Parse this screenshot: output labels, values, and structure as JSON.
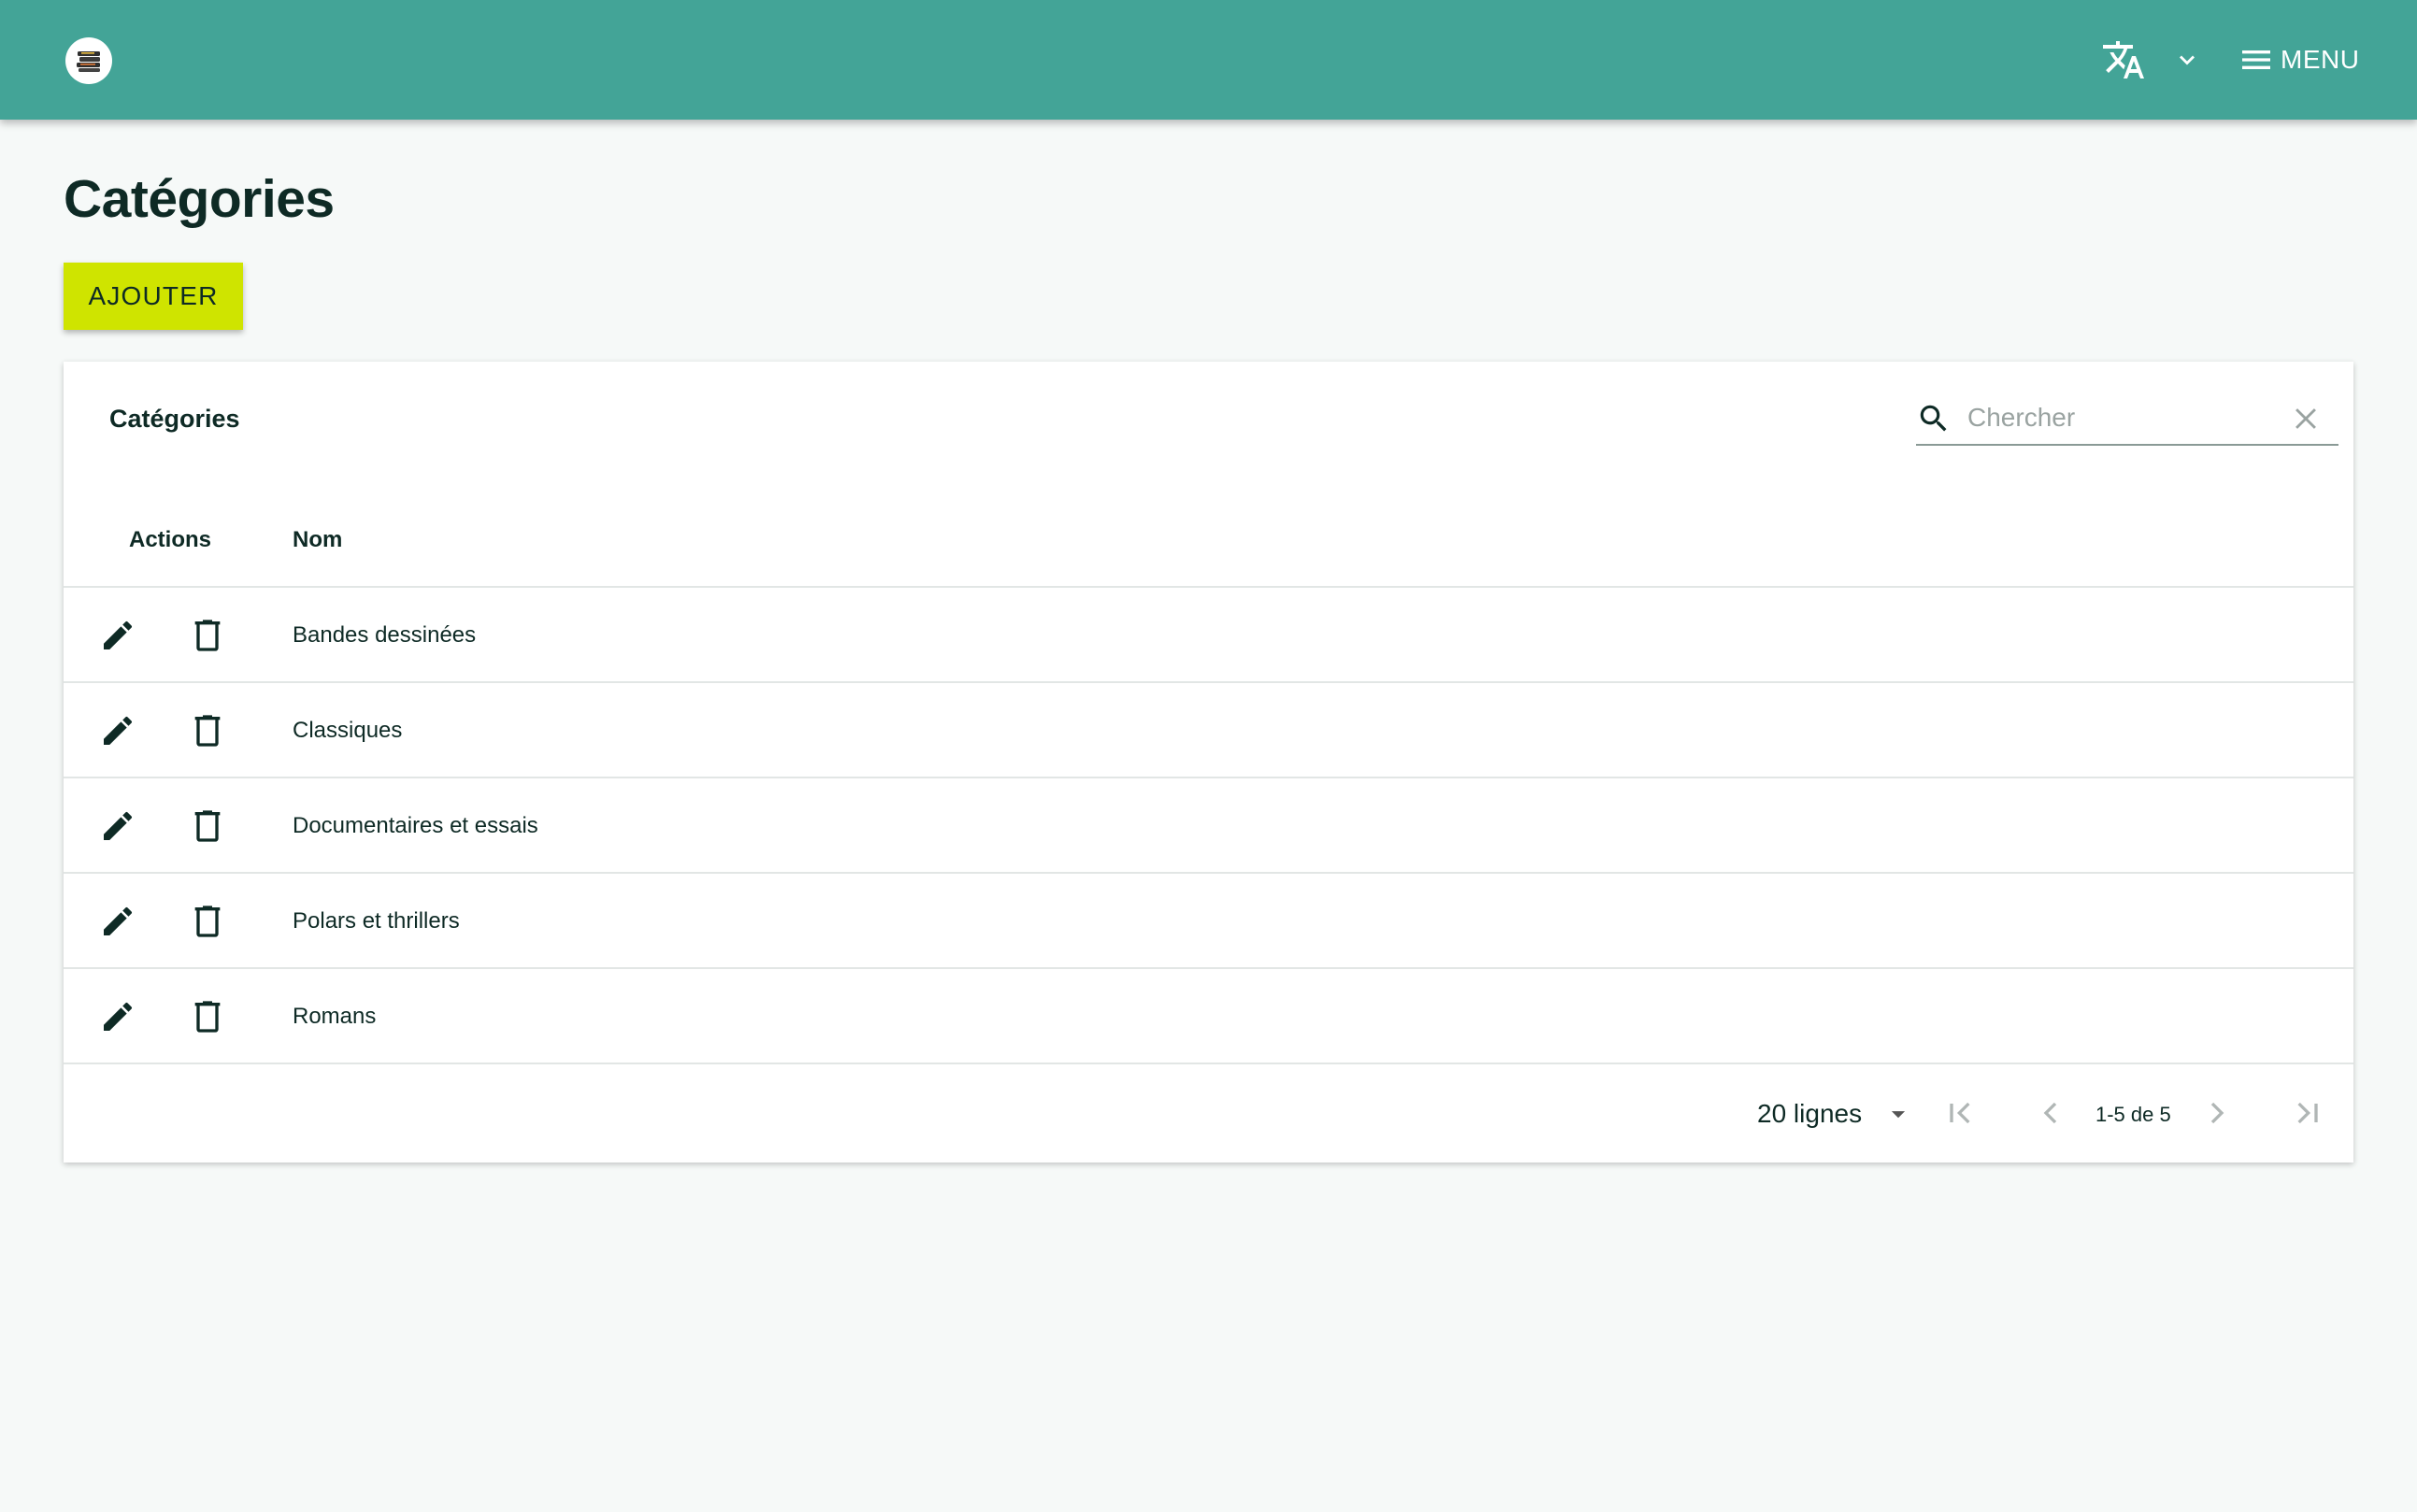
{
  "header": {
    "logo_icon": "books-stack-icon",
    "language_icon": "translate-icon",
    "menu_label": "MENU",
    "accent_color": "#43a497"
  },
  "page": {
    "title": "Catégories",
    "add_button_label": "AJOUTER",
    "add_button_color": "#cfe400"
  },
  "card": {
    "title": "Catégories",
    "search_placeholder": "Chercher",
    "search_value": "",
    "columns": [
      "Actions",
      "Nom"
    ],
    "rows": [
      {
        "name": "Bandes dessinées"
      },
      {
        "name": "Classiques"
      },
      {
        "name": "Documentaires et essais"
      },
      {
        "name": "Polars et thrillers"
      },
      {
        "name": "Romans"
      }
    ]
  },
  "pagination": {
    "rows_per_page_label": "20 lignes",
    "range_label": "1-5 de 5"
  }
}
